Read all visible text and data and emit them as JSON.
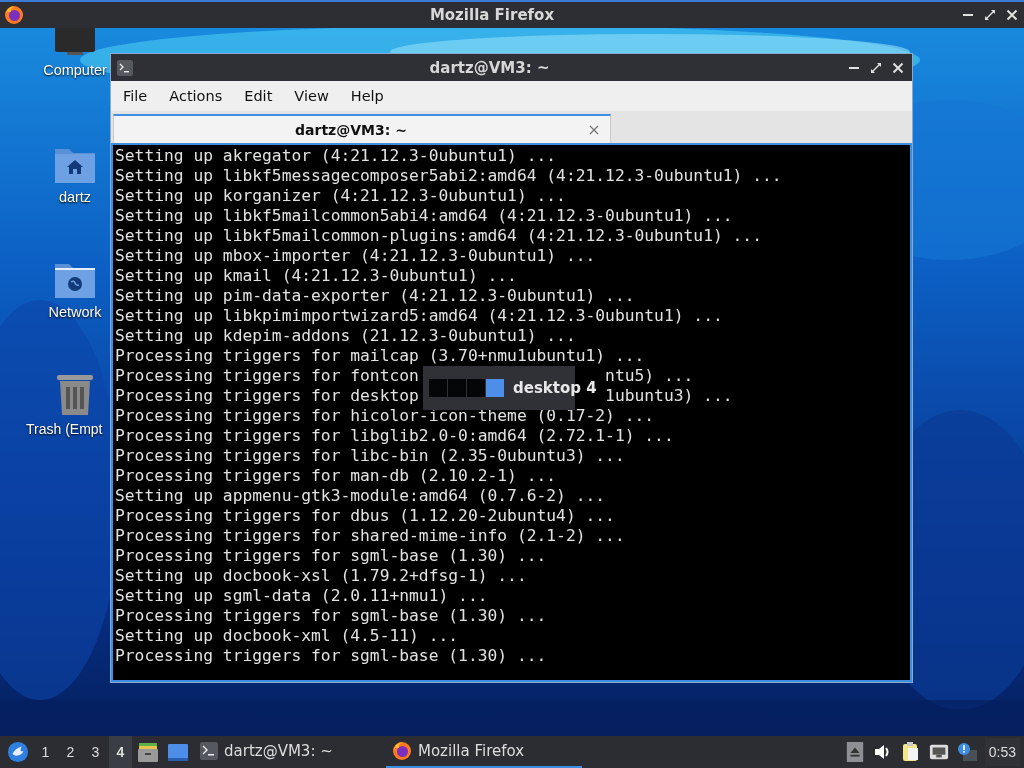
{
  "top_window": {
    "title": "Mozilla Firefox"
  },
  "desktop_icons": [
    {
      "label": "Computer",
      "kind": "computer"
    },
    {
      "label": "dartz",
      "kind": "home"
    },
    {
      "label": "Network",
      "kind": "network"
    },
    {
      "label": "Trash (Empt",
      "kind": "trash"
    }
  ],
  "terminal": {
    "title": "dartz@VM3: ~",
    "menu": [
      "File",
      "Actions",
      "Edit",
      "View",
      "Help"
    ],
    "tabs": [
      {
        "label": "dartz@VM3: ~",
        "selected": true
      }
    ],
    "lines": [
      {
        "text": "Setting up akregator (4:21.12.3-0ubuntu1) ..."
      },
      {
        "text": "Setting up libkf5messagecomposer5abi2:amd64 (4:21.12.3-0ubuntu1) ..."
      },
      {
        "text": "Setting up korganizer (4:21.12.3-0ubuntu1) ..."
      },
      {
        "text": "Setting up libkf5mailcommon5abi4:amd64 (4:21.12.3-0ubuntu1) ..."
      },
      {
        "text": "Setting up libkf5mailcommon-plugins:amd64 (4:21.12.3-0ubuntu1) ..."
      },
      {
        "text": "Setting up mbox-importer (4:21.12.3-0ubuntu1) ..."
      },
      {
        "text": "Setting up kmail (4:21.12.3-0ubuntu1) ..."
      },
      {
        "text": "Setting up pim-data-exporter (4:21.12.3-0ubuntu1) ..."
      },
      {
        "text": "Setting up libkpimimportwizard5:amd64 (4:21.12.3-0ubuntu1) ..."
      },
      {
        "text": "Setting up kdepim-addons (21.12.3-0ubuntu1) ..."
      },
      {
        "text": "Processing triggers for mailcap (3.70+nmu1ubuntu1) ..."
      },
      {
        "text": "Processing triggers for fontcon",
        "text_right": "ntu5) ..."
      },
      {
        "text": "Processing triggers for desktop",
        "text_right": "1ubuntu3) ..."
      },
      {
        "text": "Processing triggers for hicolor-icon-theme (0.17-2) ..."
      },
      {
        "text": "Processing triggers for libglib2.0-0:amd64 (2.72.1-1) ..."
      },
      {
        "text": "Processing triggers for libc-bin (2.35-0ubuntu3) ..."
      },
      {
        "text": "Processing triggers for man-db (2.10.2-1) ..."
      },
      {
        "text": "Setting up appmenu-gtk3-module:amd64 (0.7.6-2) ..."
      },
      {
        "text": "Processing triggers for dbus (1.12.20-2ubuntu4) ..."
      },
      {
        "text": "Processing triggers for shared-mime-info (2.1-2) ..."
      },
      {
        "text": "Processing triggers for sgml-base (1.30) ..."
      },
      {
        "text": "Setting up docbook-xsl (1.79.2+dfsg-1) ..."
      },
      {
        "text": "Setting up sgml-data (2.0.11+nmu1) ..."
      },
      {
        "text": "Processing triggers for sgml-base (1.30) ..."
      },
      {
        "text": "Setting up docbook-xml (4.5-11) ..."
      },
      {
        "text": "Processing triggers for sgml-base (1.30) ..."
      }
    ]
  },
  "desktop_switch_popup": {
    "desktops": [
      {
        "selected": false
      },
      {
        "selected": false
      },
      {
        "selected": false
      },
      {
        "selected": true
      }
    ],
    "label": "desktop 4"
  },
  "taskbar": {
    "workspaces": [
      {
        "label": "1",
        "selected": false
      },
      {
        "label": "2",
        "selected": false
      },
      {
        "label": "3",
        "selected": false
      },
      {
        "label": "4",
        "selected": true
      }
    ],
    "tasks": [
      {
        "label": "dartz@VM3: ~",
        "kind": "terminal",
        "selected": false
      },
      {
        "label": "Mozilla Firefox",
        "kind": "firefox",
        "selected": true
      }
    ],
    "clock": "0:53"
  }
}
